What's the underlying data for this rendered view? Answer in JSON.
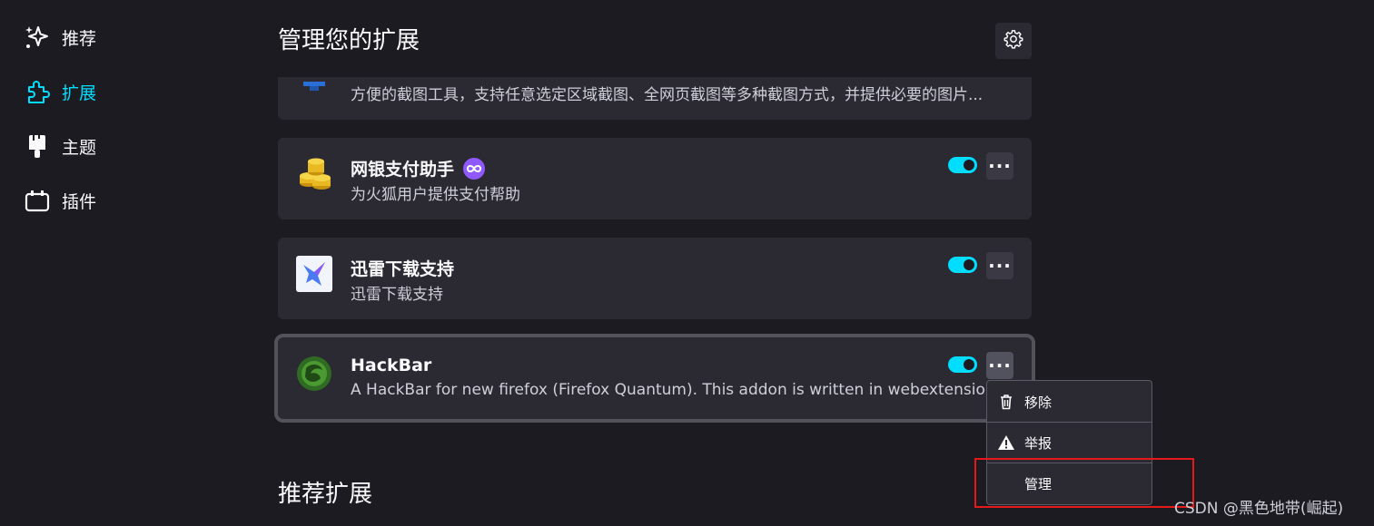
{
  "sidebar": {
    "items": [
      {
        "label": "推荐",
        "icon": "sparkle-icon"
      },
      {
        "label": "扩展",
        "icon": "puzzle-icon",
        "active": true
      },
      {
        "label": "主题",
        "icon": "brush-icon"
      },
      {
        "label": "插件",
        "icon": "plugin-icon"
      }
    ]
  },
  "main": {
    "title": "管理您的扩展",
    "settings_icon": "gear-icon",
    "extensions": [
      {
        "name": "",
        "description": "方便的截图工具，支持任意选定区域截图、全网页截图等多种截图方式，并提供必要的图片..."
      },
      {
        "name": "网银支付助手",
        "description": "为火狐用户提供支付帮助",
        "enabled": true,
        "badge_icon": "infinity-icon"
      },
      {
        "name": "迅雷下载支持",
        "description": "迅雷下载支持",
        "enabled": true
      },
      {
        "name": "HackBar",
        "description": "A HackBar for new firefox (Firefox Quantum). This addon is written in webextension",
        "enabled": true
      }
    ],
    "more_label": "···",
    "recommended_title": "推荐扩展"
  },
  "context_menu": {
    "items": [
      {
        "label": "移除",
        "icon": "trash-icon"
      },
      {
        "label": "举报",
        "icon": "warning-icon"
      },
      {
        "label": "管理",
        "icon": ""
      }
    ]
  },
  "colors": {
    "accent": "#00ddff",
    "highlight_box": "#e5191a",
    "background": "#1c1b22",
    "card": "#2b2a33"
  },
  "watermark": "CSDN @黑色地带(崛起)"
}
